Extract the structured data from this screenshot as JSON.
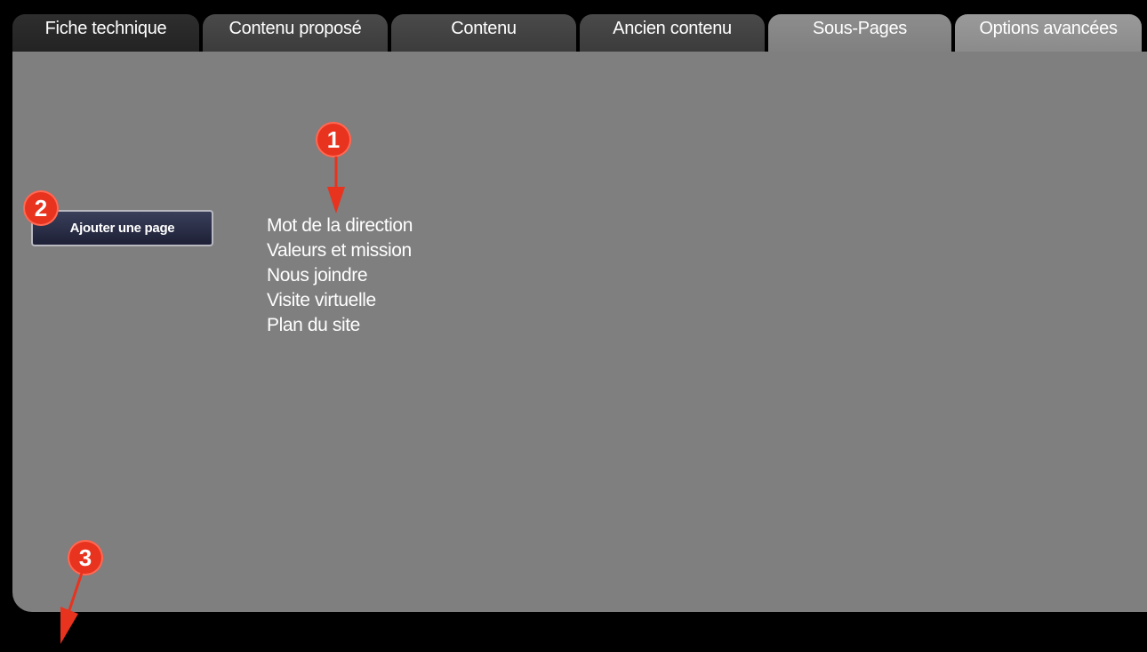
{
  "tabs": [
    {
      "label": "Fiche technique",
      "state": "dark"
    },
    {
      "label": "Contenu proposé",
      "state": "mid"
    },
    {
      "label": "Contenu",
      "state": "mid"
    },
    {
      "label": "Ancien contenu",
      "state": "mid"
    },
    {
      "label": "Sous-Pages",
      "state": "active"
    },
    {
      "label": "Options avancées",
      "state": "light"
    }
  ],
  "actions": {
    "add_page_label": "Ajouter une page"
  },
  "subpages": [
    "Mot de la direction",
    "Valeurs et mission",
    "Nous joindre",
    "Visite virtuelle",
    "Plan du site"
  ],
  "annotations": [
    {
      "number": "1"
    },
    {
      "number": "2"
    },
    {
      "number": "3"
    }
  ],
  "colors": {
    "background": "#000000",
    "panel": "#7f7f7f",
    "active_tab": "#8a8a8a",
    "annotation_marker": "#e8331f",
    "button": "#2a2e48"
  }
}
